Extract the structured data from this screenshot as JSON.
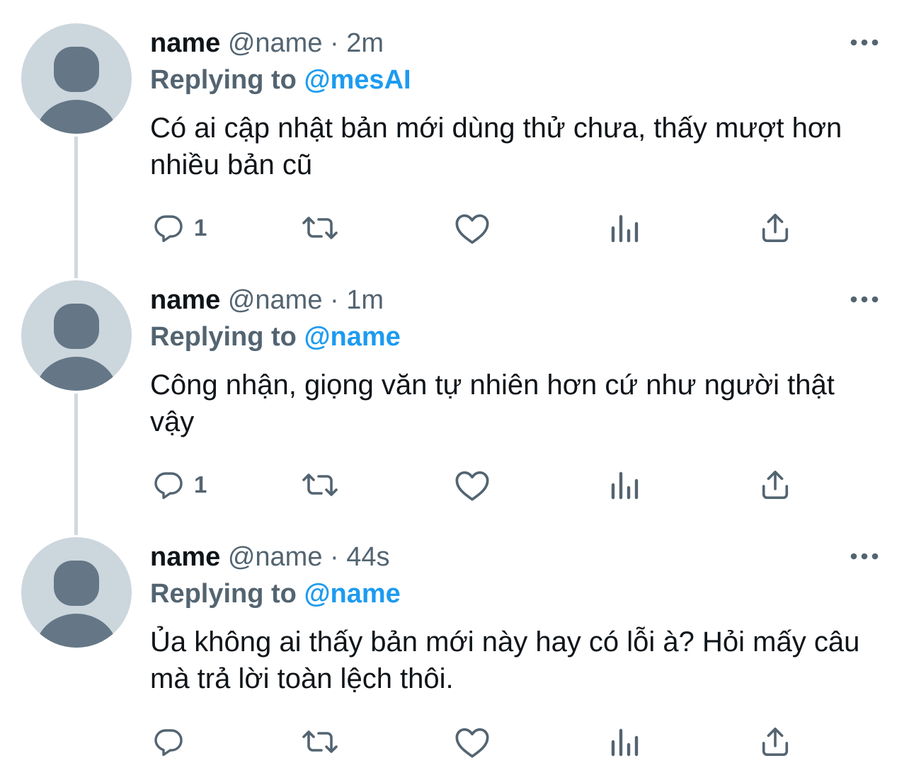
{
  "thread": [
    {
      "display_name": "name",
      "handle": "@name",
      "separator": "·",
      "time": "2m",
      "reply_prefix": "Replying to",
      "reply_to": "@mesAI",
      "text": "Có ai cập nhật bản mới dùng thử chưa, thấy mượt hơn nhiều bản cũ",
      "reply_count": "1"
    },
    {
      "display_name": "name",
      "handle": "@name",
      "separator": "·",
      "time": "1m",
      "reply_prefix": "Replying to",
      "reply_to": "@name",
      "text": "Công nhận, giọng văn tự nhiên hơn cứ như người thật vậy",
      "reply_count": "1"
    },
    {
      "display_name": "name",
      "handle": "@name",
      "separator": "·",
      "time": "44s",
      "reply_prefix": "Replying to",
      "reply_to": "@name",
      "text": "Ủa không ai thấy bản mới này hay có lỗi à? Hỏi mấy câu mà trả lời toàn lệch thôi.",
      "reply_count": ""
    }
  ],
  "icons": {
    "more": "more-horizontal-icon",
    "reply": "reply-bubble-icon",
    "retweet": "retweet-icon",
    "like": "heart-icon",
    "views": "analytics-icon",
    "share": "share-icon"
  },
  "colors": {
    "link": "#1d9bf0",
    "secondary_text": "#536471",
    "primary_text": "#0f1419",
    "avatar_bg": "#ccd6dd",
    "avatar_figure": "#657786",
    "thread_line": "#cfd9de"
  }
}
